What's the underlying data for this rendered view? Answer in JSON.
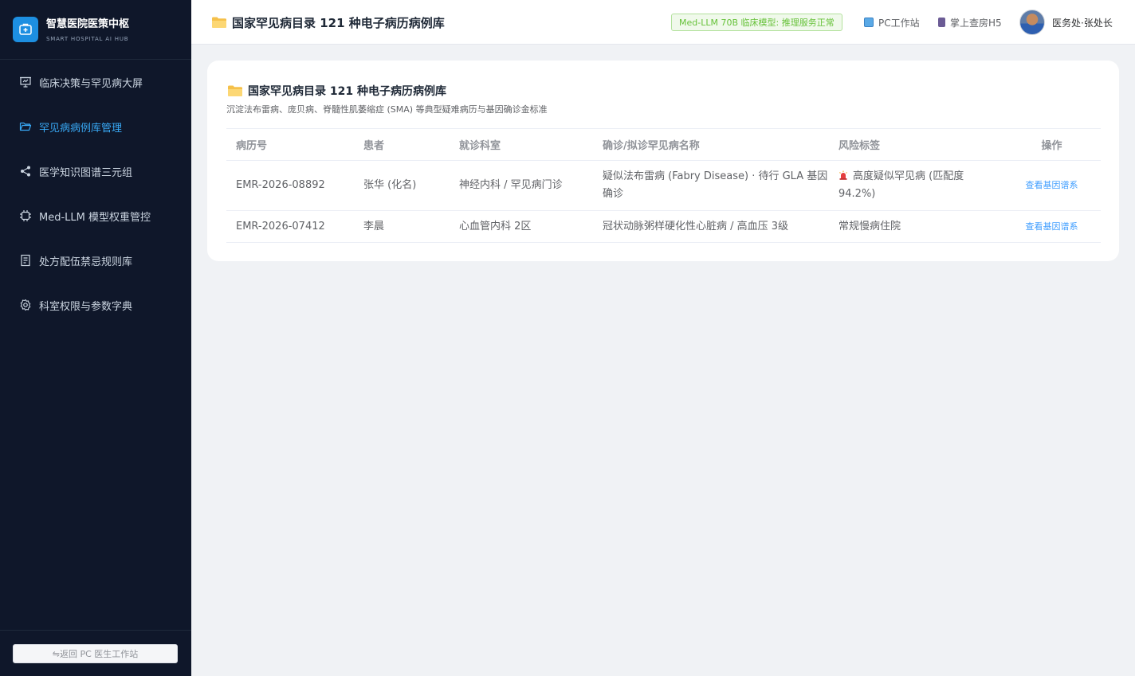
{
  "brand": {
    "title": "智慧医院医策中枢",
    "subtitle": "SMART HOSPITAL AI HUB"
  },
  "sidebar": {
    "items": [
      {
        "label": "临床决策与罕见病大屏",
        "icon": "presentation-icon",
        "active": false
      },
      {
        "label": "罕见病病例库管理",
        "icon": "folder-open-icon",
        "active": true
      },
      {
        "label": "医学知识图谱三元组",
        "icon": "share-nodes-icon",
        "active": false
      },
      {
        "label": "Med-LLM 模型权重管控",
        "icon": "chip-icon",
        "active": false
      },
      {
        "label": "处方配伍禁忌规则库",
        "icon": "document-icon",
        "active": false
      },
      {
        "label": "科室权限与参数字典",
        "icon": "gear-icon",
        "active": false
      }
    ],
    "back_button": "⇋返回 PC 医生工作站"
  },
  "header": {
    "title": "国家罕见病目录 121 种电子病历病例库",
    "status": "Med-LLM 70B 临床模型: 推理服务正常",
    "pc_link": "PC工作站",
    "mobile_link": "掌上查房H5",
    "user": "医务处·张处长"
  },
  "card": {
    "title": "国家罕见病目录 121 种电子病历病例库",
    "subtitle": "沉淀法布雷病、庞贝病、脊髓性肌萎缩症 (SMA) 等典型疑难病历与基因确诊金标准",
    "columns": [
      "病历号",
      "患者",
      "就诊科室",
      "确诊/拟诊罕见病名称",
      "风险标签",
      "操作"
    ],
    "rows": [
      {
        "emr": "EMR-2026-08892",
        "patient": "张华 (化名)",
        "dept": "神经内科 / 罕见病门诊",
        "diagnosis": "疑似法布雷病 (Fabry Disease) · 待行 GLA 基因确诊",
        "risk": "高度疑似罕见病 (匹配度 94.2%)",
        "risk_icon": "siren-icon",
        "action": "查看基因谱系"
      },
      {
        "emr": "EMR-2026-07412",
        "patient": "李晨",
        "dept": "心血管内科 2区",
        "diagnosis": "冠状动脉粥样硬化性心脏病 / 高血压 3级",
        "risk": "常规慢病住院",
        "action": "查看基因谱系"
      }
    ]
  },
  "colors": {
    "sidebar_bg": "#0f172a",
    "accent": "#38a9f5",
    "status_green": "#67c23a",
    "link_blue": "#409eff"
  }
}
